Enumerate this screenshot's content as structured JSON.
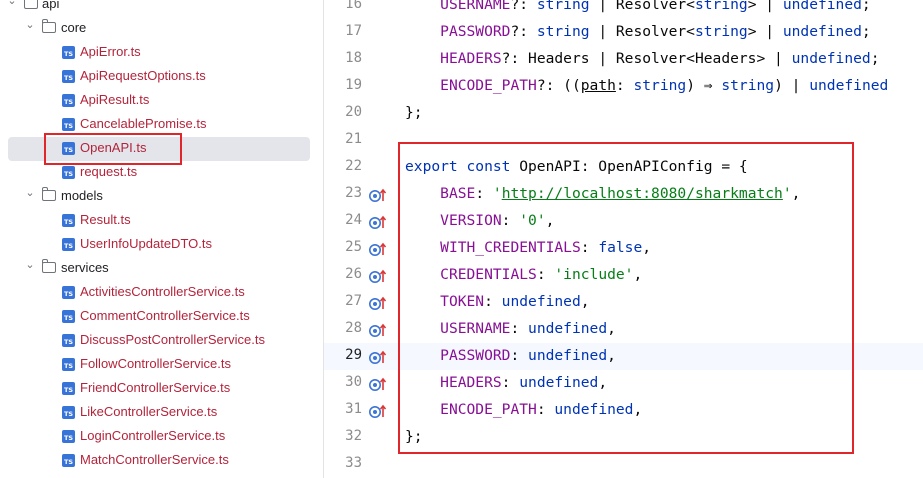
{
  "project_tree": {
    "items": [
      {
        "label": "api",
        "type": "folder",
        "depth": 0,
        "expanded": true
      },
      {
        "label": "core",
        "type": "folder",
        "depth": 1,
        "expanded": true
      },
      {
        "label": "ApiError.ts",
        "type": "ts",
        "depth": 2
      },
      {
        "label": "ApiRequestOptions.ts",
        "type": "ts",
        "depth": 2
      },
      {
        "label": "ApiResult.ts",
        "type": "ts",
        "depth": 2
      },
      {
        "label": "CancelablePromise.ts",
        "type": "ts",
        "depth": 2
      },
      {
        "label": "OpenAPI.ts",
        "type": "ts",
        "depth": 2,
        "selected": true
      },
      {
        "label": "request.ts",
        "type": "ts",
        "depth": 2
      },
      {
        "label": "models",
        "type": "folder",
        "depth": 1,
        "expanded": true
      },
      {
        "label": "Result.ts",
        "type": "ts",
        "depth": 2
      },
      {
        "label": "UserInfoUpdateDTO.ts",
        "type": "ts",
        "depth": 2
      },
      {
        "label": "services",
        "type": "folder",
        "depth": 1,
        "expanded": true
      },
      {
        "label": "ActivitiesControllerService.ts",
        "type": "ts",
        "depth": 2
      },
      {
        "label": "CommentControllerService.ts",
        "type": "ts",
        "depth": 2
      },
      {
        "label": "DiscussPostControllerService.ts",
        "type": "ts",
        "depth": 2
      },
      {
        "label": "FollowControllerService.ts",
        "type": "ts",
        "depth": 2
      },
      {
        "label": "FriendControllerService.ts",
        "type": "ts",
        "depth": 2
      },
      {
        "label": "LikeControllerService.ts",
        "type": "ts",
        "depth": 2
      },
      {
        "label": "LoginControllerService.ts",
        "type": "ts",
        "depth": 2
      },
      {
        "label": "MatchControllerService.ts",
        "type": "ts",
        "depth": 2
      }
    ],
    "ts_badge": "TS"
  },
  "editor": {
    "current_line": "29",
    "lines": [
      {
        "num": "16",
        "gutter": "",
        "tokens": [
          {
            "t": "    "
          },
          {
            "t": "USERNAME",
            "c": "prop"
          },
          {
            "t": "?: "
          },
          {
            "t": "string",
            "c": "kw"
          },
          {
            "t": " | Resolver<"
          },
          {
            "t": "string",
            "c": "kw"
          },
          {
            "t": "> | "
          },
          {
            "t": "undefined",
            "c": "kw"
          },
          {
            "t": ";"
          }
        ]
      },
      {
        "num": "17",
        "gutter": "",
        "tokens": [
          {
            "t": "    "
          },
          {
            "t": "PASSWORD",
            "c": "prop"
          },
          {
            "t": "?: "
          },
          {
            "t": "string",
            "c": "kw"
          },
          {
            "t": " | Resolver<"
          },
          {
            "t": "string",
            "c": "kw"
          },
          {
            "t": "> | "
          },
          {
            "t": "undefined",
            "c": "kw"
          },
          {
            "t": ";"
          }
        ]
      },
      {
        "num": "18",
        "gutter": "",
        "tokens": [
          {
            "t": "    "
          },
          {
            "t": "HEADERS",
            "c": "prop"
          },
          {
            "t": "?: Headers | Resolver<Headers> | "
          },
          {
            "t": "undefined",
            "c": "kw"
          },
          {
            "t": ";"
          }
        ]
      },
      {
        "num": "19",
        "gutter": "",
        "tokens": [
          {
            "t": "    "
          },
          {
            "t": "ENCODE_PATH",
            "c": "prop"
          },
          {
            "t": "?: (("
          },
          {
            "t": "path",
            "c": "ul"
          },
          {
            "t": ": "
          },
          {
            "t": "string",
            "c": "kw"
          },
          {
            "t": ") ⇒ "
          },
          {
            "t": "string",
            "c": "kw"
          },
          {
            "t": ") | "
          },
          {
            "t": "undefined",
            "c": "kw"
          }
        ]
      },
      {
        "num": "20",
        "gutter": "",
        "tokens": [
          {
            "t": "};"
          }
        ]
      },
      {
        "num": "21",
        "gutter": "",
        "tokens": []
      },
      {
        "num": "22",
        "gutter": "",
        "tokens": [
          {
            "t": "export const ",
            "c": "kw"
          },
          {
            "t": "OpenAPI: OpenAPIConfig = {"
          }
        ]
      },
      {
        "num": "23",
        "gutter": "impl",
        "tokens": [
          {
            "t": "    "
          },
          {
            "t": "BASE",
            "c": "prop"
          },
          {
            "t": ": "
          },
          {
            "t": "'",
            "c": "str"
          },
          {
            "t": "http://localhost:8080/sharkmatch",
            "c": "str url"
          },
          {
            "t": "'",
            "c": "str"
          },
          {
            "t": ","
          }
        ]
      },
      {
        "num": "24",
        "gutter": "impl",
        "tokens": [
          {
            "t": "    "
          },
          {
            "t": "VERSION",
            "c": "prop"
          },
          {
            "t": ": "
          },
          {
            "t": "'0'",
            "c": "str"
          },
          {
            "t": ","
          }
        ]
      },
      {
        "num": "25",
        "gutter": "impl",
        "tokens": [
          {
            "t": "    "
          },
          {
            "t": "WITH_CREDENTIALS",
            "c": "prop"
          },
          {
            "t": ": "
          },
          {
            "t": "false",
            "c": "kw"
          },
          {
            "t": ","
          }
        ]
      },
      {
        "num": "26",
        "gutter": "impl",
        "tokens": [
          {
            "t": "    "
          },
          {
            "t": "CREDENTIALS",
            "c": "prop"
          },
          {
            "t": ": "
          },
          {
            "t": "'include'",
            "c": "str"
          },
          {
            "t": ","
          }
        ]
      },
      {
        "num": "27",
        "gutter": "impl",
        "tokens": [
          {
            "t": "    "
          },
          {
            "t": "TOKEN",
            "c": "prop"
          },
          {
            "t": ": "
          },
          {
            "t": "undefined",
            "c": "kw"
          },
          {
            "t": ","
          }
        ]
      },
      {
        "num": "28",
        "gutter": "impl",
        "tokens": [
          {
            "t": "    "
          },
          {
            "t": "USERNAME",
            "c": "prop"
          },
          {
            "t": ": "
          },
          {
            "t": "undefined",
            "c": "kw"
          },
          {
            "t": ","
          }
        ]
      },
      {
        "num": "29",
        "gutter": "impl",
        "tokens": [
          {
            "t": "    "
          },
          {
            "t": "PASSWORD",
            "c": "prop"
          },
          {
            "t": ": "
          },
          {
            "t": "undefined",
            "c": "kw"
          },
          {
            "t": ","
          }
        ]
      },
      {
        "num": "30",
        "gutter": "impl",
        "tokens": [
          {
            "t": "    "
          },
          {
            "t": "HEADERS",
            "c": "prop"
          },
          {
            "t": ": "
          },
          {
            "t": "undefined",
            "c": "kw"
          },
          {
            "t": ","
          }
        ]
      },
      {
        "num": "31",
        "gutter": "impl",
        "tokens": [
          {
            "t": "    "
          },
          {
            "t": "ENCODE_PATH",
            "c": "prop"
          },
          {
            "t": ": "
          },
          {
            "t": "undefined",
            "c": "kw"
          },
          {
            "t": ","
          }
        ]
      },
      {
        "num": "32",
        "gutter": "",
        "tokens": [
          {
            "t": "};"
          }
        ]
      },
      {
        "num": "33",
        "gutter": "",
        "tokens": []
      }
    ]
  },
  "colors": {
    "keyword": "#0033b3",
    "property": "#871094",
    "string": "#067d17",
    "file_label": "#b3243b",
    "highlight_box": "#e0262b",
    "selection_bg": "#e3e5ea",
    "ts_badge": "#3874d8"
  }
}
